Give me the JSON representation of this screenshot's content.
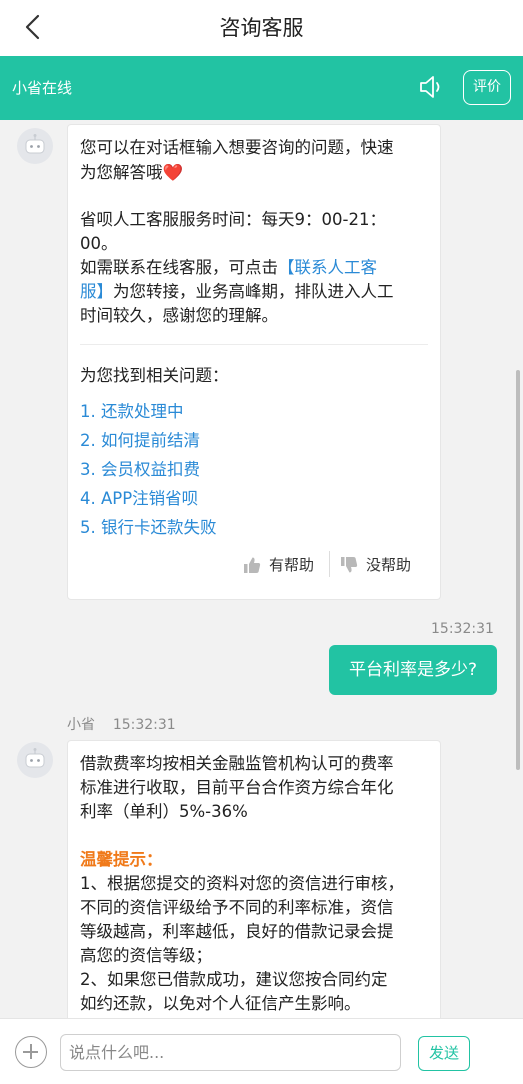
{
  "header": {
    "title": "咨询客服"
  },
  "agent_bar": {
    "name": "小省在线",
    "rate_label": "评价"
  },
  "welcome": {
    "line1": "您可以在对话框输入想要咨询的问题，快速",
    "line2": "为您解答哦",
    "heart": "❤️",
    "hours_line1": "省呗人工客服服务时间：每天9：00-21：",
    "hours_line2": "00。",
    "contact_prefix": "如需联系在线客服，可点击",
    "contact_link1": "【联系人工客",
    "contact_link2": "服】",
    "contact_suffix": "为您转接，业务高峰期，排队进入人工",
    "contact_line3": "时间较久，感谢您的理解。",
    "related_title": "为您找到相关问题：",
    "questions": [
      "1. 还款处理中",
      "2. 如何提前结清",
      "3. 会员权益扣费",
      "4. APP注销省呗",
      "5. 银行卡还款失败"
    ],
    "helpful": "有帮助",
    "not_helpful": "没帮助"
  },
  "user_message": {
    "time": "15:32:31",
    "text": "平台利率是多少?"
  },
  "agent_reply": {
    "sender": "小省",
    "time": "15:32:31",
    "p1": [
      "借款费率均按相关金融监管机构认可的费率",
      "标准进行收取，目前平台合作资方综合年化",
      "利率（单利）5%-36%"
    ],
    "tip_title": "温馨提示：",
    "p2": [
      "1、根据您提交的资料对您的资信进行审核，",
      "不同的资信评级给予不同的利率标准，资信",
      "等级越高，利率越低，良好的借款记录会提",
      "高您的资信等级；",
      "2、如果您已借款成功，建议您按合同约定",
      "如约还款，以免对个人征信产生影响。"
    ]
  },
  "composer": {
    "placeholder": "说点什么吧...",
    "send_label": "发送"
  },
  "colors": {
    "accent": "#22c3a3",
    "link": "#2a8ad6",
    "tip": "#f07a1a"
  },
  "icons": [
    "back-arrow-icon",
    "speaker-icon",
    "robot-avatar-icon",
    "thumbs-up-icon",
    "thumbs-down-icon",
    "plus-icon"
  ]
}
